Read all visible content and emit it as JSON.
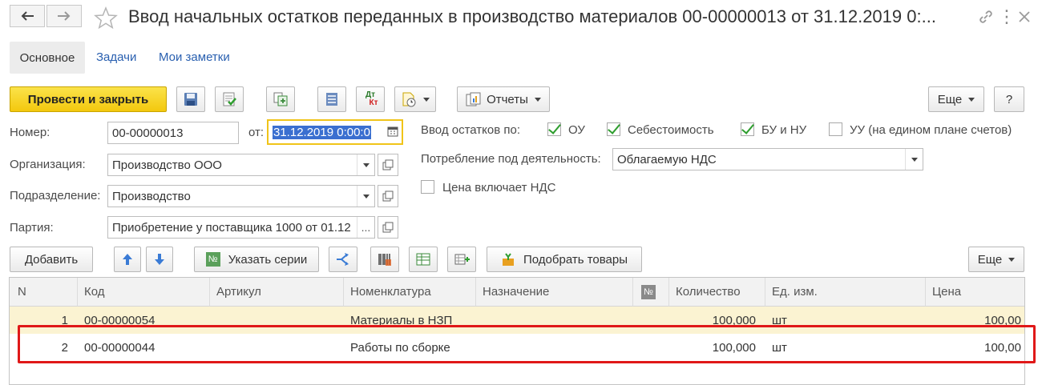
{
  "header": {
    "title": "Ввод начальных остатков переданных в производство материалов 00-00000013 от 31.12.2019 0:..."
  },
  "tabs": {
    "main": "Основное",
    "tasks": "Задачи",
    "notes": "Мои заметки"
  },
  "toolbar": {
    "post_close": "Провести и закрыть",
    "dt_kt_top": "Дт",
    "dt_kt_bottom": "Кт",
    "reports": "Отчеты",
    "more": "Еще",
    "help": "?"
  },
  "form": {
    "number_label": "Номер:",
    "number_value": "00-00000013",
    "date_label": "от:",
    "date_value": "31.12.2019  0:00:0",
    "org_label": "Организация:",
    "org_value": "Производство ООО",
    "dept_label": "Подразделение:",
    "dept_value": "Производство",
    "batch_label": "Партия:",
    "batch_value": "Приобретение у поставщика 1000 от 01.12",
    "balances_label": "Ввод остатков по:",
    "check_ou": "ОУ",
    "check_cost": "Себестоимость",
    "check_bu": "БУ и НУ",
    "check_uu": "УУ (на едином плане счетов)",
    "consumption_label": "Потребление под деятельность:",
    "consumption_value": "Облагаемую НДС",
    "vat_included": "Цена включает НДС"
  },
  "checks": {
    "ou": true,
    "cost": true,
    "bu": true,
    "uu": false,
    "vat": false
  },
  "table_toolbar": {
    "add": "Добавить",
    "series": "Указать серии",
    "series_icon_text": "№",
    "pick_goods": "Подобрать товары",
    "more": "Еще"
  },
  "table": {
    "columns": [
      "N",
      "Код",
      "Артикул",
      "Номенклатура",
      "Назначение",
      "№",
      "Количество",
      "Ед. изм.",
      "Цена"
    ],
    "rows": [
      {
        "n": "1",
        "code": "00-00000054",
        "article": "",
        "item": "Материалы в НЗП",
        "purpose": "",
        "qty": "100,000",
        "unit": "шт",
        "price": "100,00"
      },
      {
        "n": "2",
        "code": "00-00000044",
        "article": "",
        "item": "Работы по сборке",
        "purpose": "",
        "qty": "100,000",
        "unit": "шт",
        "price": "100,00"
      }
    ]
  },
  "colors": {
    "primary_button": "#f3c80e",
    "link": "#2a60b0",
    "selected_row": "#fbf3d2",
    "highlight": "#e01818",
    "check": "#2f9e2f"
  }
}
